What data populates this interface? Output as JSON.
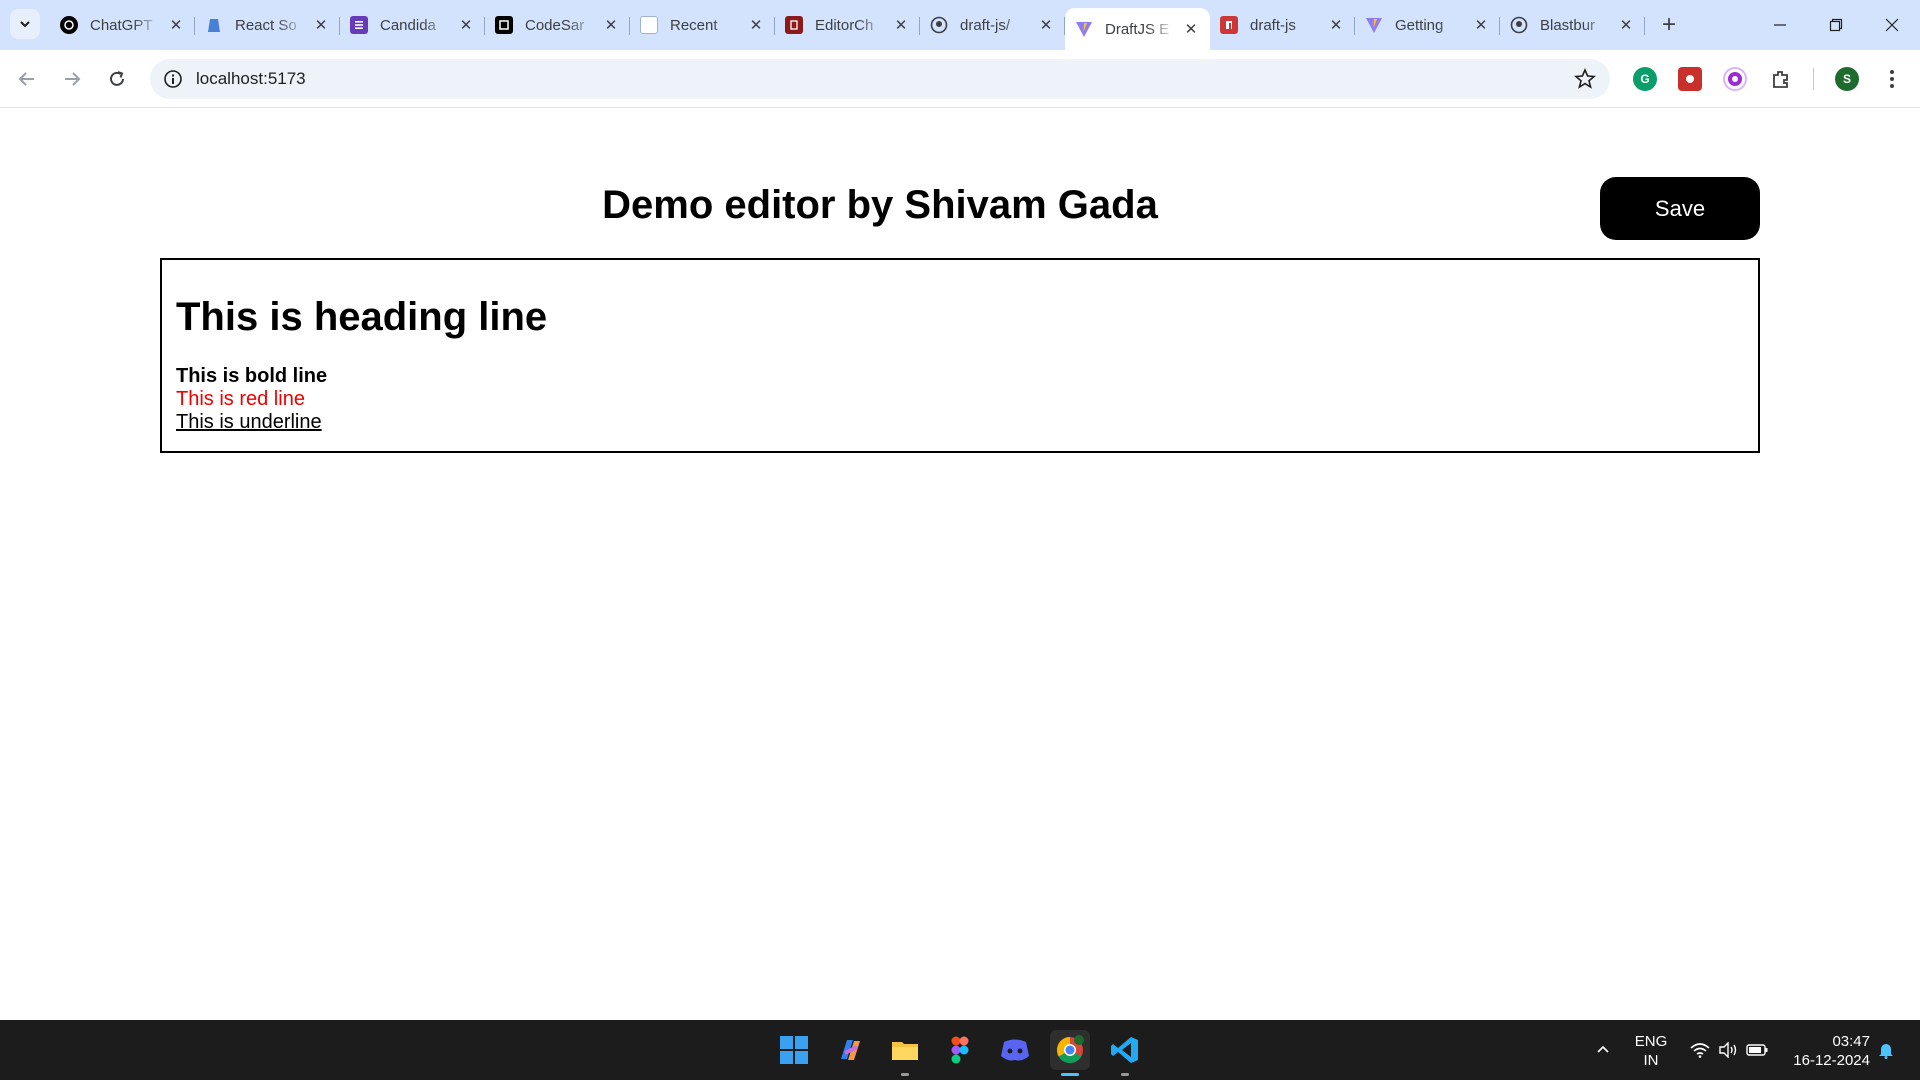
{
  "browser": {
    "tabs": [
      {
        "title": "ChatGPT",
        "icon": "chatgpt-icon",
        "active": false
      },
      {
        "title": "React So",
        "icon": "react-icon",
        "active": false
      },
      {
        "title": "Candida",
        "icon": "form-icon",
        "active": false
      },
      {
        "title": "CodeSar",
        "icon": "codesandbox-icon",
        "active": false
      },
      {
        "title": "Recent",
        "icon": "page-icon",
        "active": false
      },
      {
        "title": "EditorCh",
        "icon": "book-icon",
        "active": false
      },
      {
        "title": "draft-js/",
        "icon": "github-icon",
        "active": false
      },
      {
        "title": "DraftJS E",
        "icon": "vite-icon",
        "active": true
      },
      {
        "title": "draft-js",
        "icon": "npm-icon",
        "active": false
      },
      {
        "title": "Getting",
        "icon": "vite-icon",
        "active": false
      },
      {
        "title": "Blastbur",
        "icon": "github-icon",
        "active": false
      }
    ],
    "address_bar": {
      "url": "localhost:5173"
    },
    "profile_initial": "S"
  },
  "page": {
    "title": "Demo editor by Shivam Gada",
    "save_label": "Save",
    "editor": {
      "heading": "This is heading line",
      "bold_line": "This is bold line",
      "red_line": "This is red line",
      "underline_line": "This is underline"
    }
  },
  "colors": {
    "tabstrip_bg": "#d3e3fd",
    "save_button_bg": "#000000",
    "red_text": "#ee0000",
    "taskbar_bg": "#1c1c1c"
  },
  "taskbar": {
    "apps": [
      "start-icon",
      "copilot-icon",
      "file-explorer-icon",
      "figma-icon",
      "discord-icon",
      "chrome-icon",
      "vscode-icon"
    ],
    "language": {
      "line1": "ENG",
      "line2": "IN"
    },
    "time": "03:47",
    "date": "16-12-2024"
  }
}
